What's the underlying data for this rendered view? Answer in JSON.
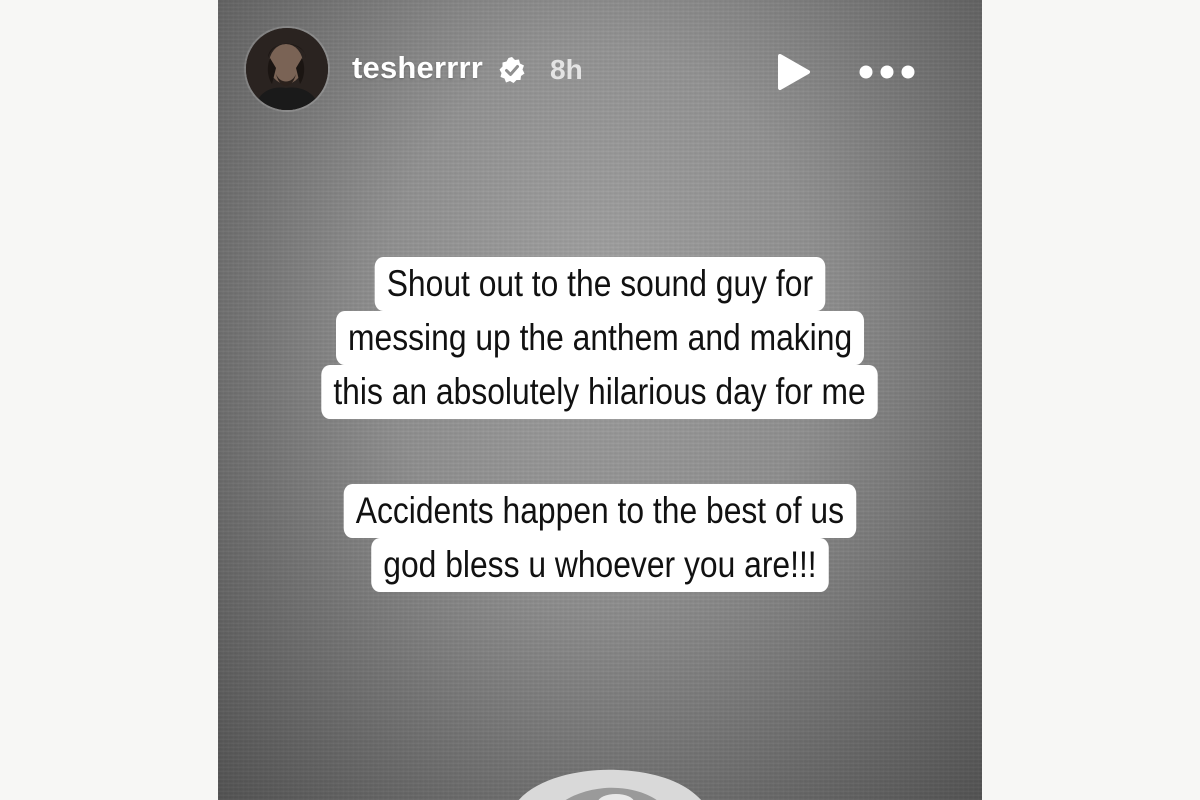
{
  "story": {
    "username": "tesherrrr",
    "verified": true,
    "time_ago": "8h",
    "icons": {
      "avatar": "profile-photo",
      "verified": "verified-badge-icon",
      "play": "play-icon",
      "more": "more-options-icon"
    },
    "captions": [
      {
        "lines": [
          "Shout out to the sound guy for",
          "messing up the anthem and making",
          "this an absolutely hilarious day for me"
        ]
      },
      {
        "lines": [
          "Accidents happen to the best of us",
          "god bless u whoever you are!!!"
        ]
      }
    ]
  },
  "colors": {
    "page_background": "#f7f7f5",
    "story_background": "#8e8e8e",
    "caption_background": "#ffffff",
    "caption_text": "#111111",
    "header_text": "#ffffff"
  }
}
